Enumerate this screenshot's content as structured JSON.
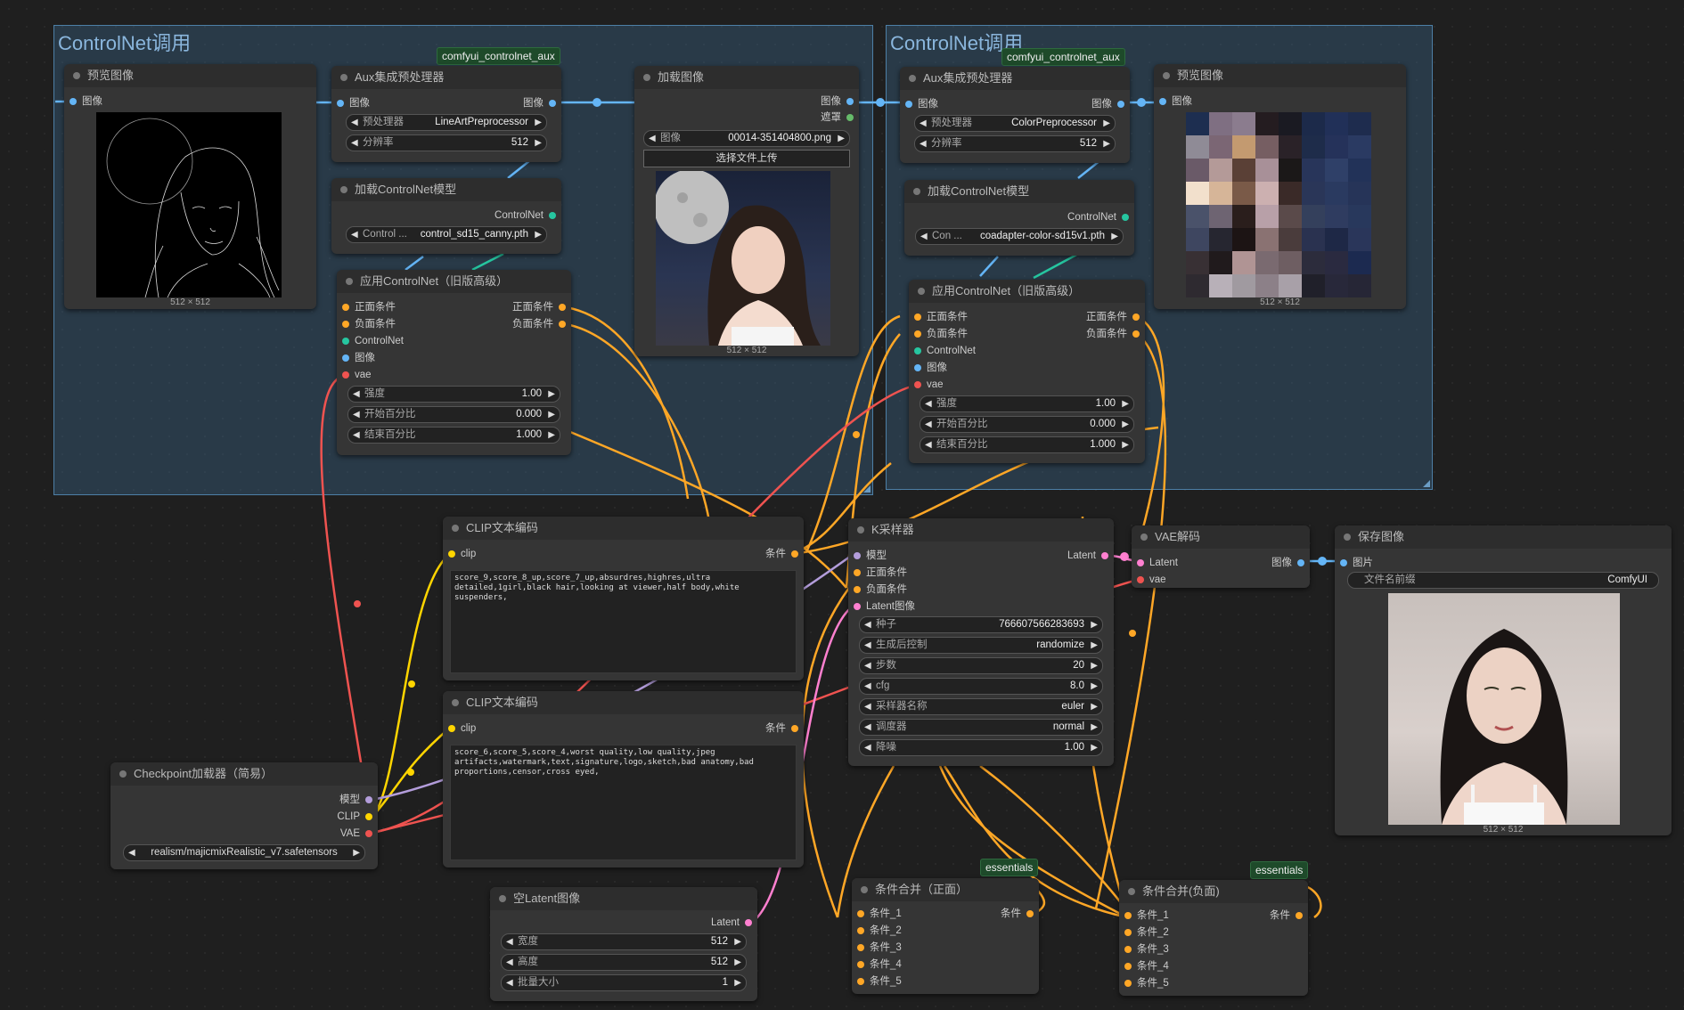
{
  "groups": [
    {
      "title": "ControlNet调用"
    },
    {
      "title": "ControlNet调用"
    }
  ],
  "badges": {
    "aux1": "comfyui_controlnet_aux",
    "aux2": "comfyui_controlnet_aux",
    "ess1": "essentials",
    "ess2": "essentials"
  },
  "preview1": {
    "title": "预览图像",
    "in_image": "图像",
    "caption": "512 × 512"
  },
  "aux1": {
    "title": "Aux集成预处理器",
    "in_image": "图像",
    "out_image": "图像",
    "pre_label": "预处理器",
    "pre_value": "LineArtPreprocessor",
    "res_label": "分辨率",
    "res_value": "512"
  },
  "loadcn1": {
    "title": "加载ControlNet模型",
    "out": "ControlNet",
    "label": "Control ...",
    "value": "control_sd15_canny.pth"
  },
  "applycn1": {
    "title": "应用ControlNet（旧版高级）",
    "in_pos": "正面条件",
    "in_neg": "负面条件",
    "in_cn": "ControlNet",
    "in_img": "图像",
    "in_vae": "vae",
    "out_pos": "正面条件",
    "out_neg": "负面条件",
    "strength_label": "强度",
    "strength": "1.00",
    "start_label": "开始百分比",
    "start": "0.000",
    "end_label": "结束百分比",
    "end": "1.000"
  },
  "loadimg": {
    "title": "加载图像",
    "out_image": "图像",
    "out_mask": "遮罩",
    "img_label": "图像",
    "img_value": "00014-351404800.png",
    "upload": "选择文件上传",
    "caption": "512 × 512"
  },
  "aux2": {
    "title": "Aux集成预处理器",
    "in_image": "图像",
    "out_image": "图像",
    "pre_label": "预处理器",
    "pre_value": "ColorPreprocessor",
    "res_label": "分辨率",
    "res_value": "512"
  },
  "preview2": {
    "title": "预览图像",
    "in_image": "图像",
    "caption": "512 × 512"
  },
  "loadcn2": {
    "title": "加载ControlNet模型",
    "out": "ControlNet",
    "label": "Con ...",
    "value": "coadapter-color-sd15v1.pth"
  },
  "applycn2": {
    "title": "应用ControlNet（旧版高级）",
    "in_pos": "正面条件",
    "in_neg": "负面条件",
    "in_cn": "ControlNet",
    "in_img": "图像",
    "in_vae": "vae",
    "out_pos": "正面条件",
    "out_neg": "负面条件",
    "strength_label": "强度",
    "strength": "1.00",
    "start_label": "开始百分比",
    "start": "0.000",
    "end_label": "结束百分比",
    "end": "1.000"
  },
  "clip1": {
    "title": "CLIP文本编码",
    "in_clip": "clip",
    "out": "条件",
    "text": "score_9,score_8_up,score_7_up,absurdres,highres,ultra detailed,1girl,black hair,looking at viewer,half body,white suspenders,"
  },
  "clip2": {
    "title": "CLIP文本编码",
    "in_clip": "clip",
    "out": "条件",
    "text": "score_6,score_5,score_4,worst quality,low quality,jpeg artifacts,watermark,text,signature,logo,sketch,bad anatomy,bad proportions,censor,cross eyed,"
  },
  "ksampler": {
    "title": "K采样器",
    "in_model": "模型",
    "in_pos": "正面条件",
    "in_neg": "负面条件",
    "in_lat": "Latent图像",
    "out": "Latent",
    "seed_label": "种子",
    "seed": "766607566283693",
    "ctrl_label": "生成后控制",
    "ctrl": "randomize",
    "steps_label": "步数",
    "steps": "20",
    "cfg_label": "cfg",
    "cfg": "8.0",
    "sampler_label": "采样器名称",
    "sampler": "euler",
    "sched_label": "调度器",
    "sched": "normal",
    "denoise_label": "降噪",
    "denoise": "1.00"
  },
  "vaedecode": {
    "title": "VAE解码",
    "in_lat": "Latent",
    "in_vae": "vae",
    "out": "图像"
  },
  "save": {
    "title": "保存图像",
    "in": "图片",
    "prefix_label": "文件名前缀",
    "prefix": "ComfyUI",
    "caption": "512 × 512"
  },
  "ckpt": {
    "title": "Checkpoint加载器（简易）",
    "out_model": "模型",
    "out_clip": "CLIP",
    "out_vae": "VAE",
    "value": "realism/majicmixRealistic_v7.safetensors"
  },
  "latent": {
    "title": "空Latent图像",
    "out": "Latent",
    "w_label": "宽度",
    "w": "512",
    "h_label": "高度",
    "h": "512",
    "b_label": "批量大小",
    "b": "1"
  },
  "combpos": {
    "title": "条件合并（正面）",
    "in1": "条件_1",
    "in2": "条件_2",
    "in3": "条件_3",
    "in4": "条件_4",
    "in5": "条件_5",
    "out": "条件"
  },
  "combneg": {
    "title": "条件合并(负面)",
    "in1": "条件_1",
    "in2": "条件_2",
    "in3": "条件_3",
    "in4": "条件_4",
    "in5": "条件_5",
    "out": "条件"
  },
  "colors": {
    "image": "#64b5f6",
    "conditioning": "#ffa726",
    "controlnet": "#26c6a0",
    "vae": "#ef5350",
    "clip": "#ffd500",
    "model": "#b39ddb",
    "latent": "#ff80d0"
  }
}
